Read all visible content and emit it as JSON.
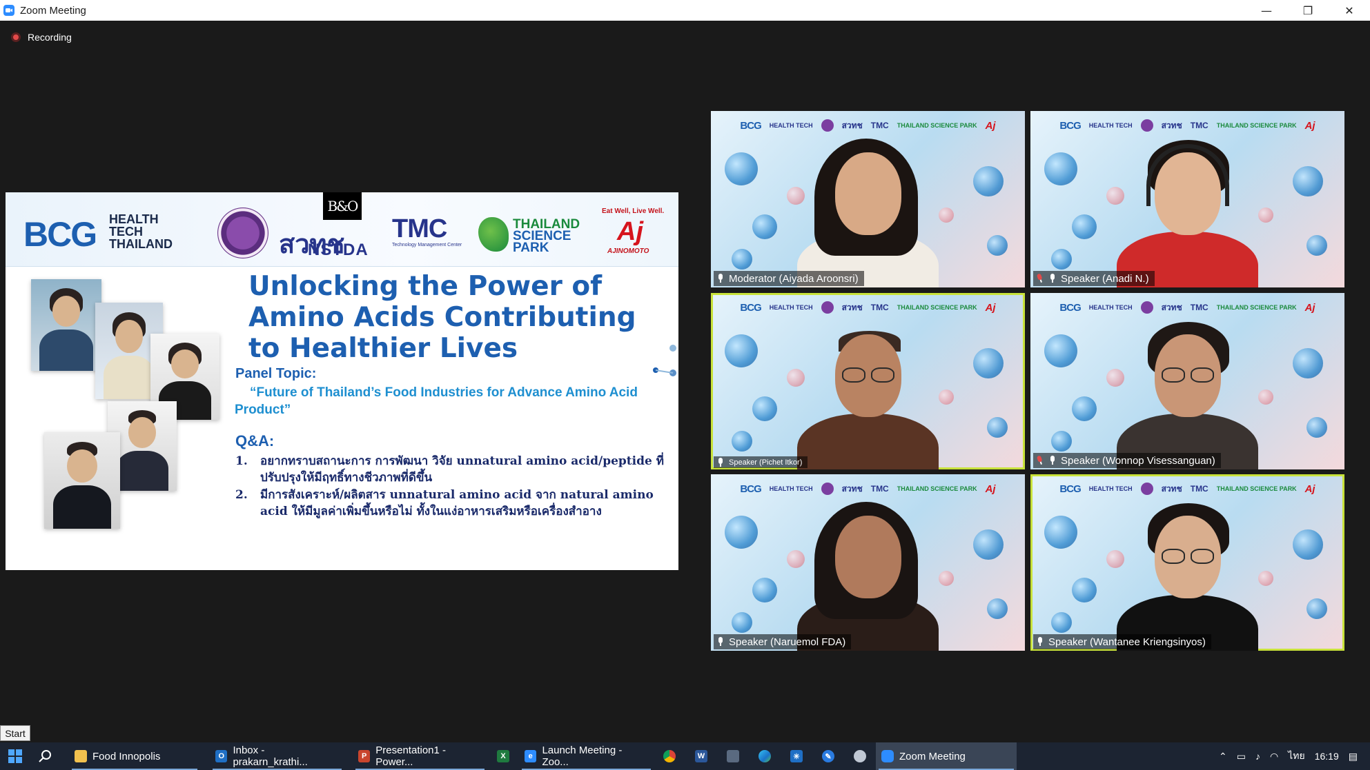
{
  "window": {
    "title": "Zoom Meeting",
    "minimize": "—",
    "restore": "❐",
    "close": "✕"
  },
  "brand_logo": "B&O",
  "recording": {
    "label": "Recording"
  },
  "slide": {
    "logos": {
      "bcg": "BCG",
      "health": [
        "HEALTH",
        "TECH",
        "THAILAND"
      ],
      "nstda_thai": "สวทช",
      "nstda": "NSTDA",
      "tmc": "TMC",
      "tmc_sub": "Technology Management Center",
      "tsp": [
        "THAILAND",
        "SCIENCE",
        "PARK"
      ],
      "aj_tag": "Eat Well, Live Well.",
      "aj": "Aj",
      "aj_sub": "AJINOMOTO"
    },
    "title": "Unlocking the Power of Amino Acids Contributing to Healthier Lives",
    "panel_label": "Panel Topic:",
    "panel_topic": "“Future of Thailand’s Food Industries for Advance Amino Acid Product”",
    "qa_label": "Q&A:",
    "qa_items": [
      {
        "num": "1.",
        "text": "อยากทราบสถานะการ การพัฒนา วิจัย unnatural amino acid/peptide ที่ปรับปรุงให้มีฤทธิ์ทางชีวภาพที่ดีขึ้น"
      },
      {
        "num": "2.",
        "text": "มีการสังเคราะห์/ผลิตสาร unnatural amino acid จาก natural amino acid ให้มีมูลค่าเพิ่มขึ้นหรือไม่ ทั้งในแง่อาหารเสริมหรือเครื่องสำอาง"
      }
    ]
  },
  "participants": [
    {
      "name": "Moderator (Aiyada Aroonsri)",
      "muted": false,
      "active": false
    },
    {
      "name": "Speaker (Anadi N.)",
      "muted": true,
      "active": false
    },
    {
      "name": "Speaker (Pichet Itkor)",
      "muted": false,
      "active": true
    },
    {
      "name": "Speaker (Wonnop Visessanguan)",
      "muted": true,
      "active": false
    },
    {
      "name": "Speaker (Naruemol FDA)",
      "muted": false,
      "active": false
    },
    {
      "name": "Speaker (Wantanee Kriengsinyos)",
      "muted": false,
      "active": true
    }
  ],
  "tile_logos": {
    "bcg": "BCG",
    "health": "HEALTH TECH",
    "nstda": "สวทช",
    "tmc": "TMC",
    "tsp": "THAILAND SCIENCE PARK",
    "aj": "Aj"
  },
  "taskbar": {
    "start_tooltip": "Start",
    "tasks": [
      {
        "label": "Food Innopolis",
        "color": "#f2c14e",
        "glyph": ""
      },
      {
        "label": "Inbox - prakarn_krathi...",
        "color": "#1f6fc5",
        "glyph": "O"
      },
      {
        "label": "Presentation1 - Power...",
        "color": "#c9452d",
        "glyph": "P"
      },
      {
        "label": "",
        "color": "#1f7a3f",
        "glyph": "X"
      },
      {
        "label": "Launch Meeting - Zoo...",
        "color": "#2d8cff",
        "glyph": "e"
      },
      {
        "label": "Zoom Meeting",
        "color": "#2d8cff",
        "glyph": ""
      }
    ],
    "pinned": [
      "chrome-icon",
      "word-icon",
      "calculator-icon",
      "edge-icon",
      "settings-icon",
      "pen-icon",
      "paint-icon"
    ],
    "tray": {
      "language": "ไทย",
      "time": "16:19"
    }
  },
  "colors": {
    "accent": "#2d8cff",
    "active_speaker": "#c8e23a",
    "slide_title": "#1d5fb0",
    "recording": "#e34a4a"
  }
}
